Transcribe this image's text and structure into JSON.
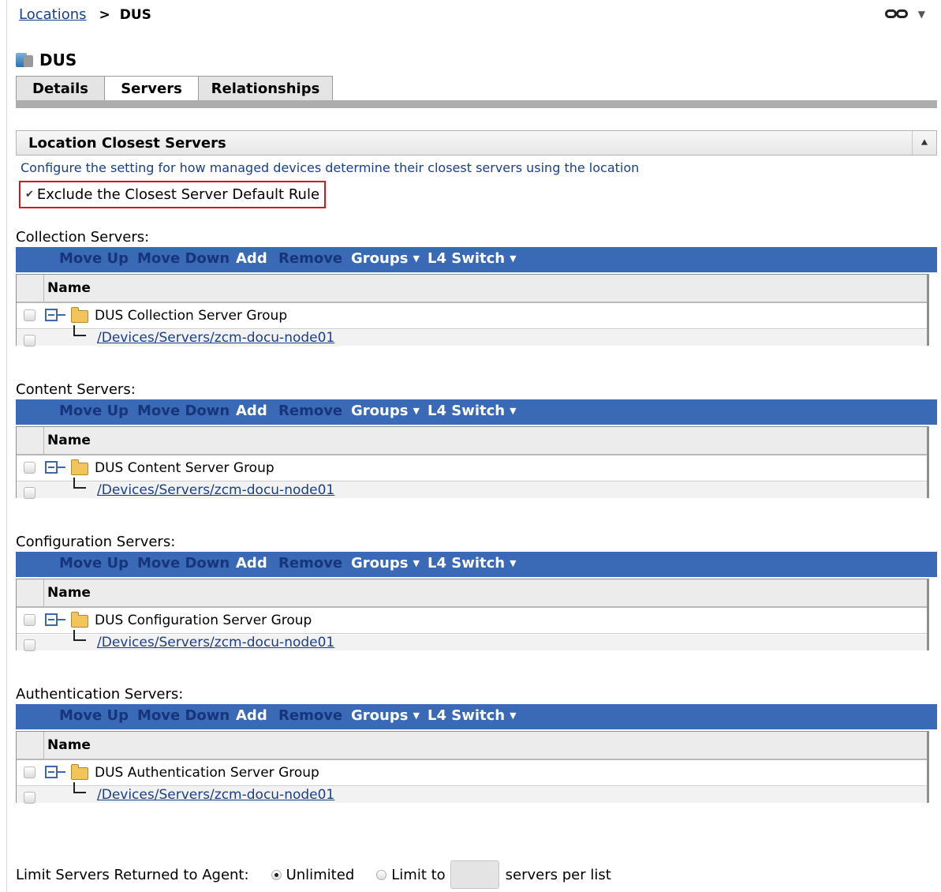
{
  "breadcrumb": {
    "parent": "Locations",
    "separator": ">",
    "current": "DUS"
  },
  "page_title": "DUS",
  "tabs": [
    {
      "label": "Details",
      "active": false
    },
    {
      "label": "Servers",
      "active": true
    },
    {
      "label": "Relationships",
      "active": false
    }
  ],
  "panel": {
    "title": "Location Closest Servers",
    "description": "Configure the setting for how managed devices determine their closest servers using the location",
    "exclude_label": "Exclude the Closest Server Default Rule",
    "exclude_checked": true
  },
  "toolbar": {
    "move_up": "Move Up",
    "move_down": "Move Down",
    "add": "Add",
    "remove": "Remove",
    "groups": "Groups",
    "l4_switch": "L4 Switch"
  },
  "grid_header": "Name",
  "sections": [
    {
      "label": "Collection Servers:",
      "group": "DUS Collection Server Group",
      "device": "/Devices/Servers/zcm-docu-node01"
    },
    {
      "label": "Content Servers:",
      "group": "DUS Content Server Group",
      "device": "/Devices/Servers/zcm-docu-node01"
    },
    {
      "label": "Configuration Servers:",
      "group": "DUS Configuration Server Group",
      "device": "/Devices/Servers/zcm-docu-node01"
    },
    {
      "label": "Authentication Servers:",
      "group": "DUS Authentication Server Group",
      "device": "/Devices/Servers/zcm-docu-node01"
    }
  ],
  "limit": {
    "label": "Limit Servers Returned to Agent:",
    "option_unlimited": "Unlimited",
    "option_limit": "Limit to",
    "suffix": "servers per list",
    "selected": "Unlimited",
    "value": ""
  },
  "colors": {
    "toolbar_bg": "#3a69b5",
    "link": "#1a3f8a",
    "highlight_border": "#d8141d"
  },
  "icons": [
    "link-icon",
    "location-icon",
    "collapse-icon",
    "folder-icon",
    "tree-expand-icon",
    "dropdown-caret-icon"
  ]
}
